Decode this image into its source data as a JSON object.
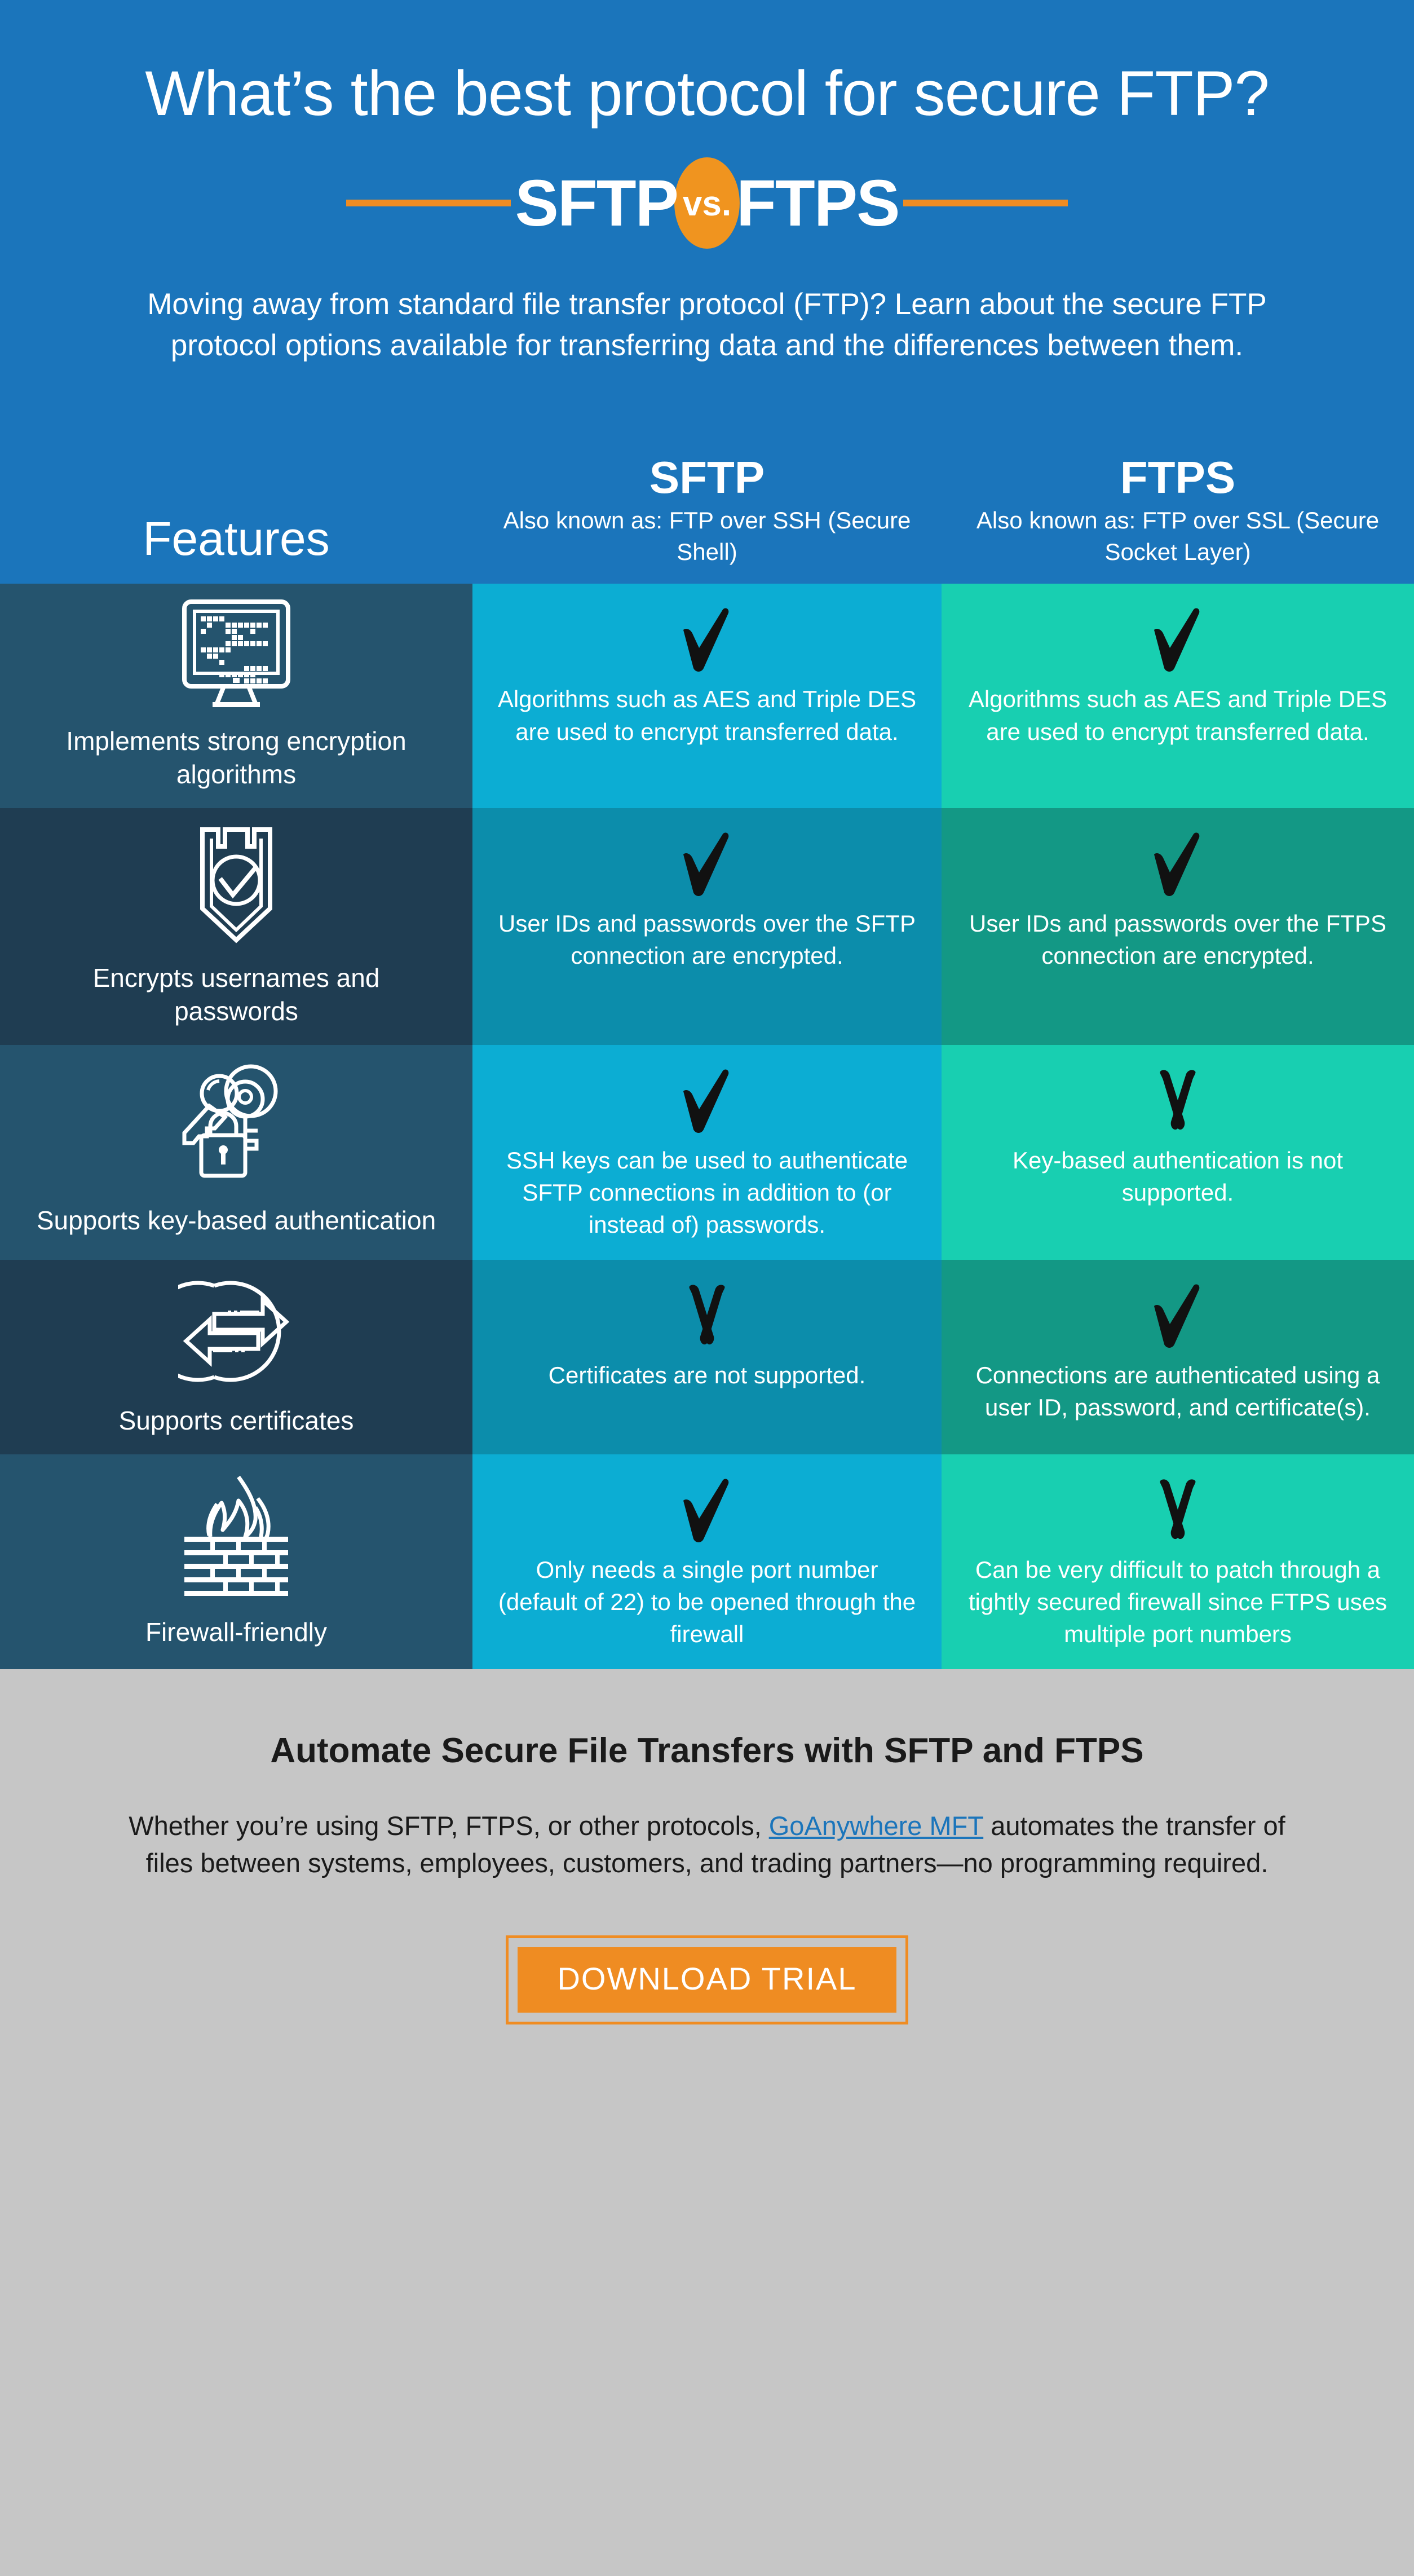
{
  "hero": {
    "title": "What’s the best protocol for secure FTP?",
    "vs_left": "SFTP",
    "vs_badge": "vs.",
    "vs_right": "FTPS",
    "subtitle": "Moving away from standard file transfer protocol (FTP)? Learn about the secure FTP protocol options available for transferring data and the differences between them.",
    "bg_color": "#1b75bb",
    "accent_color": "#ef8c22"
  },
  "table": {
    "features_header": "Features",
    "columns": [
      {
        "name": "SFTP",
        "subtitle": "Also known as: FTP over SSH (Secure Shell)",
        "color": "#0cadd3"
      },
      {
        "name": "FTPS",
        "subtitle": "Also known as: FTP over SSL (Secure Socket Layer)",
        "color": "#18cfb1"
      }
    ],
    "rows": [
      {
        "feature": "Implements strong encryption algorithms",
        "icon": "monitor-qr-code-icon",
        "sftp": {
          "mark": "check",
          "text": "Algorithms such as AES and Triple DES are used to encrypt transferred data."
        },
        "ftps": {
          "mark": "check",
          "text": "Algorithms such as AES and Triple DES are used to encrypt transferred data."
        }
      },
      {
        "feature": "Encrypts usernames and passwords",
        "icon": "shield-check-icon",
        "sftp": {
          "mark": "check",
          "text": "User IDs and passwords over the SFTP connection are encrypted."
        },
        "ftps": {
          "mark": "check",
          "text": "User IDs and passwords over the FTPS connection are encrypted."
        }
      },
      {
        "feature": "Supports key-based authentication",
        "icon": "keys-padlock-icon",
        "sftp": {
          "mark": "check",
          "text": "SSH keys can be used to authenticate SFTP connections in addition to (or instead of) passwords."
        },
        "ftps": {
          "mark": "cross",
          "text": "Key-based authentication is not supported."
        }
      },
      {
        "feature": "Supports certificates",
        "icon": "transfer-arrows-icon",
        "sftp": {
          "mark": "cross",
          "text": "Certificates are not supported."
        },
        "ftps": {
          "mark": "check",
          "text": "Connections are authenticated using a user ID, password, and certificate(s)."
        }
      },
      {
        "feature": "Firewall-friendly",
        "icon": "firewall-brick-flame-icon",
        "sftp": {
          "mark": "check",
          "text": "Only needs a single port number (default of 22) to be opened through the firewall"
        },
        "ftps": {
          "mark": "cross",
          "text": "Can be very difficult to patch through a tightly secured firewall since FTPS uses multiple port numbers"
        }
      }
    ]
  },
  "footer": {
    "title": "Automate Secure File Transfers with SFTP and FTPS",
    "body_before": "Whether you’re using SFTP, FTPS, or other protocols, ",
    "link_text": "GoAnywhere MFT",
    "body_after": " automates the transfer of files between systems, employees, customers, and trading partners—no programming required.",
    "button_label": "DOWNLOAD TRIAL",
    "bg_color": "#c6c6c6",
    "link_color": "#1b75bb",
    "button_color": "#ef8c22"
  }
}
